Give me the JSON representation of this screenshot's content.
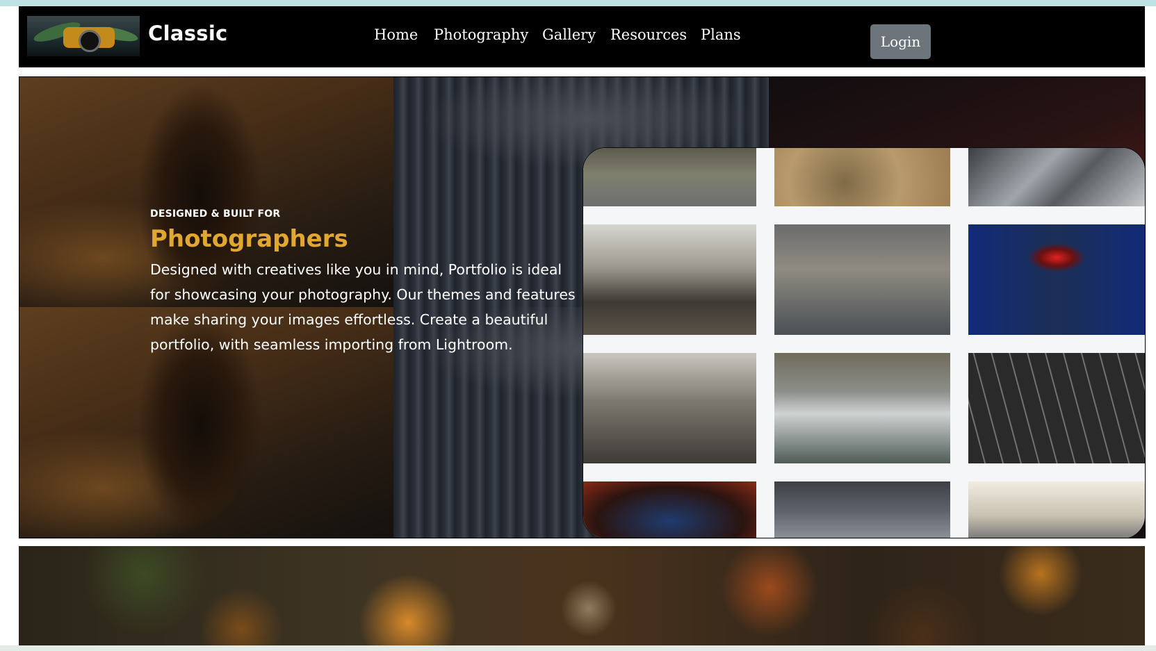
{
  "navbar": {
    "brand": "Classic",
    "logo_icon": "camera-logo-icon",
    "items": [
      {
        "label": "Home"
      },
      {
        "label": "Photography"
      },
      {
        "label": "Gallery"
      },
      {
        "label": "Resources"
      },
      {
        "label": "Plans"
      }
    ],
    "login_label": "Login"
  },
  "hero": {
    "eyebrow": "DESIGNED & BUILT FOR",
    "headline": "Photographers",
    "description": "Designed with creatives like you in mind, Portfolio is ideal for showcasing your photography. Our themes and features make sharing your images effortless. Create a beautiful portfolio, with seamless importing from Lightroom.",
    "headline_color": "#e0a830"
  },
  "colors": {
    "navbar_bg": "#000000",
    "login_bg": "#6d747c",
    "gallery_bg": "#f5f6f8"
  }
}
